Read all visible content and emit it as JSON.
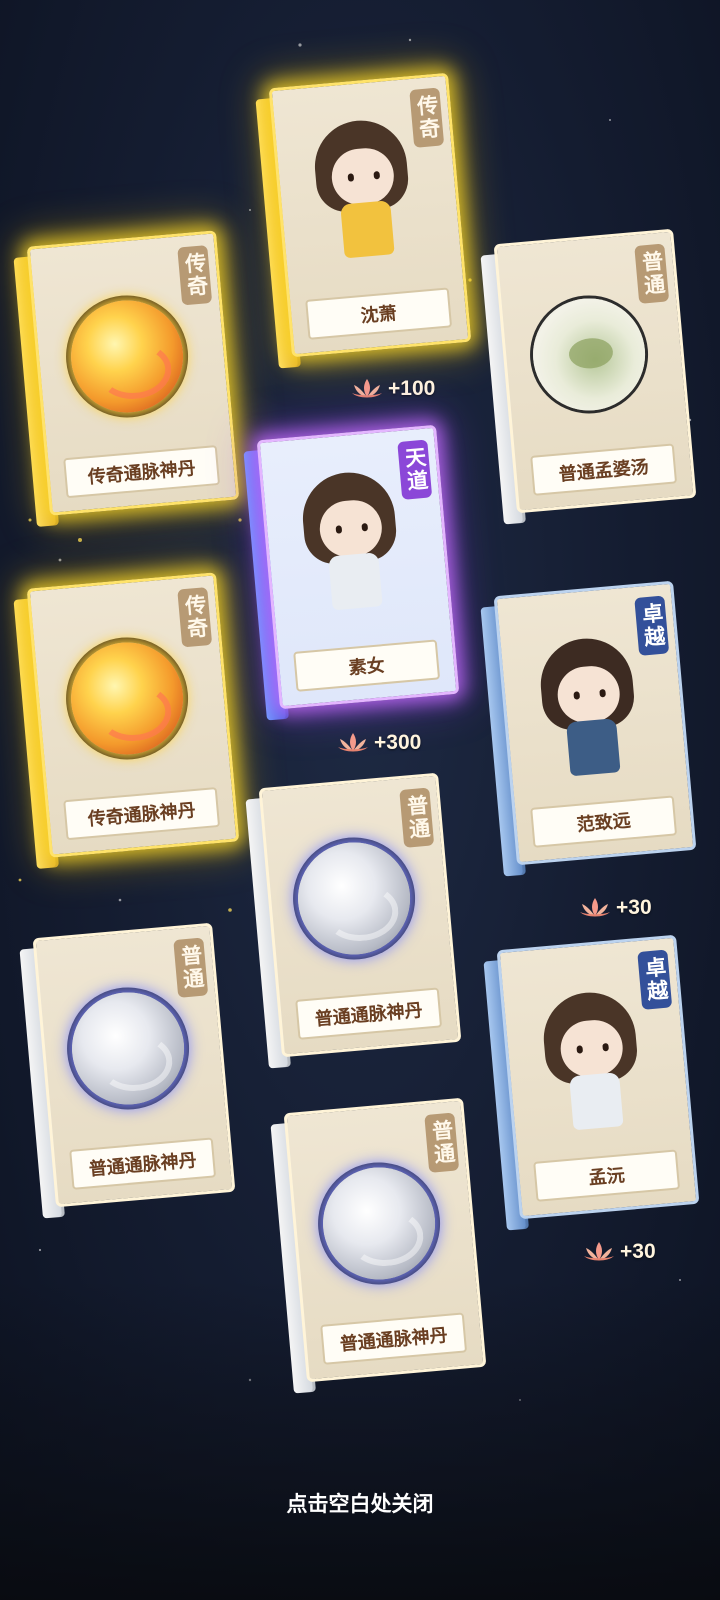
{
  "cards": [
    {
      "id": "c1",
      "rarity": "传奇",
      "name": "传奇通脉神丹"
    },
    {
      "id": "c2",
      "rarity": "传奇",
      "name": "沈萧"
    },
    {
      "id": "c3",
      "rarity": "普通",
      "name": "普通孟婆汤"
    },
    {
      "id": "c4",
      "rarity": "传奇",
      "name": "传奇通脉神丹"
    },
    {
      "id": "c5",
      "rarity": "天道",
      "name": "素女"
    },
    {
      "id": "c6",
      "rarity": "卓越",
      "name": "范致远"
    },
    {
      "id": "c7",
      "rarity": "普通",
      "name": "普通通脉神丹"
    },
    {
      "id": "c8",
      "rarity": "普通",
      "name": "普通通脉神丹"
    },
    {
      "id": "c9",
      "rarity": "卓越",
      "name": "孟沅"
    },
    {
      "id": "c10",
      "rarity": "普通",
      "name": "普通通脉神丹"
    }
  ],
  "rewards": [
    {
      "label": "+100",
      "icon": "lotus-icon"
    },
    {
      "label": "+300",
      "icon": "lotus-icon"
    },
    {
      "label": "+30",
      "icon": "lotus-icon"
    },
    {
      "label": "+30",
      "icon": "lotus-icon"
    }
  ],
  "close_hint": "点击空白处关闭",
  "colors": {
    "legend_glow": "#ffd83a",
    "heaven_glow": "#b45cff",
    "excellent_badge": "#33509a",
    "normal_badge": "#b79a74",
    "name_text": "#6a3f22"
  }
}
